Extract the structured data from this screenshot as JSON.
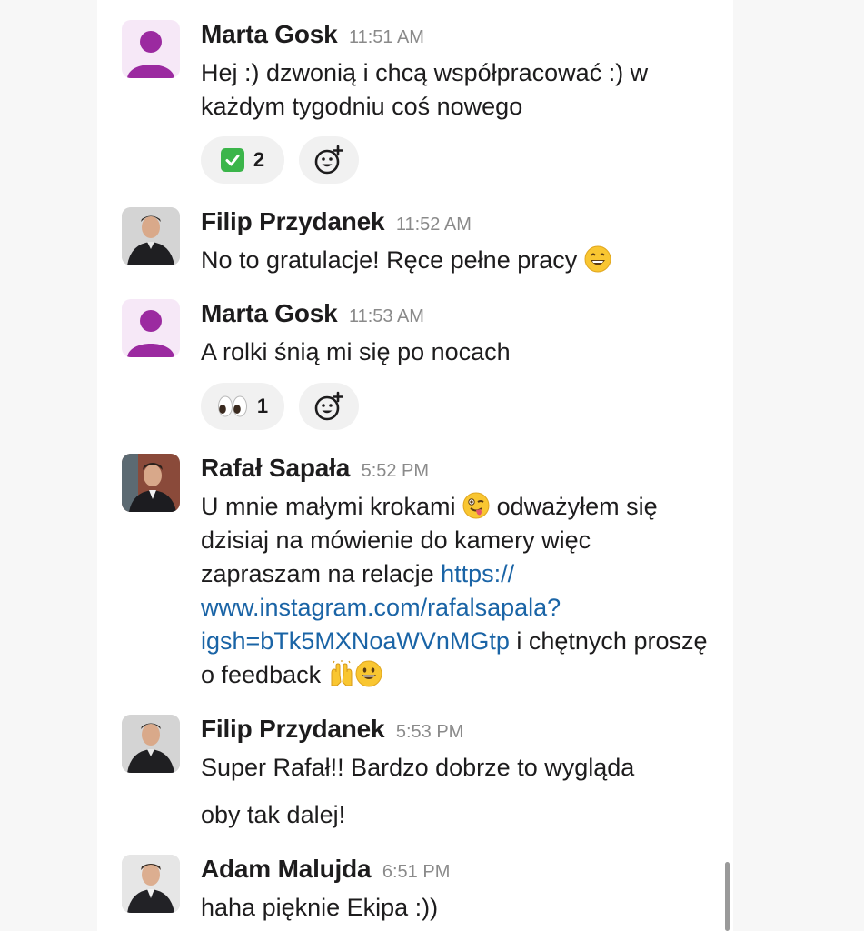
{
  "messages": [
    {
      "author": "Marta Gosk",
      "time": "11:51 AM",
      "avatar": "person-placeholder-icon",
      "body": "Hej :) dzwonią i chcą współpracować :) w każdym tygodniu coś nowego",
      "reactions": [
        {
          "emoji": "white-check-mark-icon",
          "count": "2"
        }
      ]
    },
    {
      "author": "Filip Przydanek",
      "time": "11:52 AM",
      "avatar": "user-photo",
      "body": "No to gratulacje! Ręce pełne pracy",
      "body_emoji": "grinning-face-icon"
    },
    {
      "author": "Marta Gosk",
      "time": "11:53 AM",
      "avatar": "person-placeholder-icon",
      "body": "A rolki śnią mi się po nocach",
      "reactions": [
        {
          "emoji": "eyes-icon",
          "count": "1"
        }
      ]
    },
    {
      "author": "Rafał Sapała",
      "time": "5:52 PM",
      "avatar": "user-photo",
      "body_parts": {
        "p1": "U mnie małymi krokami",
        "p2": " odważyłem się dzisiaj na mówienie do kamery więc zapraszam na relacje ",
        "link": "https://www.instagram.com/rafalsapala?igsh=bTk5MXNoaWVnMGtp",
        "link_line1": "https://",
        "link_line2": "www.instagram.com/rafalsapala?",
        "link_line3": "igsh=bTk5MXNoaWVnMGtp",
        "p3": " i chętnych proszę o feedback"
      }
    },
    {
      "author": "Filip Przydanek",
      "time": "5:53 PM",
      "avatar": "user-photo",
      "body": "Super Rafał!! Bardzo dobrze to wygląda",
      "body_line2": "oby tak dalej!"
    },
    {
      "author": "Adam Malujda",
      "time": "6:51 PM",
      "avatar": "user-photo",
      "body": "haha pięknie Ekipa :))"
    }
  ],
  "colors": {
    "placeholder_avatar_bg": "#f6e8f7",
    "placeholder_avatar_fg": "#9b2aa0",
    "link": "#1a64a6",
    "timestamp": "#8a8a8a",
    "reaction_bg": "#f1f1f1"
  }
}
